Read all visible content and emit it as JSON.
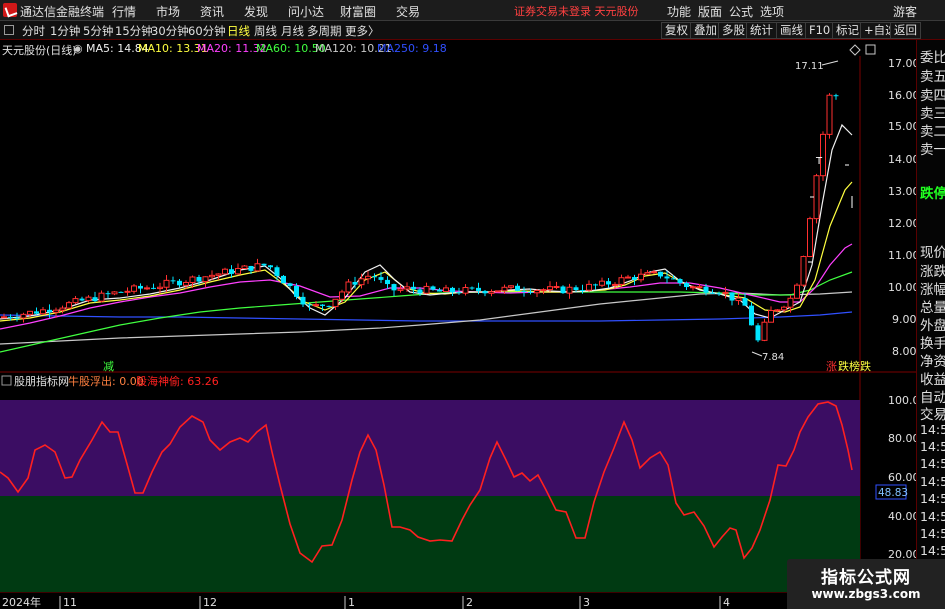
{
  "titlebar": {
    "app_title": "通达信金融终端",
    "menus": [
      "行情",
      "市场",
      "资讯",
      "发现",
      "问小达",
      "财富圈",
      "交易"
    ],
    "status": "证券交易未登录  天元股份",
    "right_menus": [
      "功能",
      "版面",
      "公式",
      "选项"
    ],
    "guest": "游客"
  },
  "tabbar": {
    "periods": [
      "分时",
      "1分钟",
      "5分钟",
      "15分钟",
      "30分钟",
      "60分钟",
      "日线",
      "周线",
      "月线",
      "多周期",
      "更多"
    ],
    "active_period": "日线",
    "more_suffix": "〉",
    "buttons": [
      "复权",
      "叠加",
      "多股",
      "统计",
      "画线",
      "F10",
      "标记",
      "+自选",
      "返回"
    ]
  },
  "main_info": {
    "stock_label": "天元股份(日线)",
    "ma": [
      {
        "label": "MA5: 14.84",
        "color": "#f0f0f0"
      },
      {
        "label": "MA10: 13.31",
        "color": "#ffff40"
      },
      {
        "label": "MA20: 11.32",
        "color": "#ff40ff"
      },
      {
        "label": "MA60: 10.50",
        "color": "#40ff40"
      },
      {
        "label": "MA120: 10.21",
        "color": "#c8c8c8"
      },
      {
        "label": "MA250: 9.18",
        "color": "#3050ff"
      }
    ]
  },
  "price_axis": [
    "17.00",
    "16.00",
    "15.00",
    "14.00",
    "13.00",
    "12.00",
    "11.00",
    "10.00",
    "9.00",
    "8.00"
  ],
  "annotations": {
    "high": "17.11",
    "low": "7.84",
    "reduce_marker": "减",
    "limit_marker": "涨",
    "limit_text": "跌榜跌",
    "t_mark": "T"
  },
  "indicator": {
    "name": "股朋指标网",
    "line1_label": "牛股浮出: 0.00",
    "line2_label": "股海神偷: 63.26",
    "axis": [
      "100.00",
      "80.00",
      "60.00",
      "40.00",
      "20.00"
    ],
    "current_value": "48.83"
  },
  "date_axis": [
    "2024年",
    "11",
    "12",
    "1",
    "2",
    "3",
    "4"
  ],
  "right_panel": {
    "items": [
      "委比",
      "卖五",
      "卖四",
      "卖三",
      "卖二",
      "卖一"
    ],
    "mid": "跌停",
    "items2": [
      "现价",
      "涨跌",
      "涨幅",
      "总量",
      "外盘",
      "换手",
      "净资",
      "收益"
    ],
    "auto_trade": [
      "自动",
      "交易"
    ],
    "times": [
      "14:5",
      "14:5",
      "14:5",
      "14:5",
      "14:5",
      "14:5",
      "14:5",
      "14:5"
    ]
  },
  "watermark": {
    "title": "指标公式网",
    "url": "www.zbgs3.com"
  },
  "colors": {
    "up": "#ff3030",
    "down": "#00e5ff",
    "purple_zone": "#3b0d63",
    "green_zone": "#003a12",
    "indicator_line": "#ff2020"
  }
}
